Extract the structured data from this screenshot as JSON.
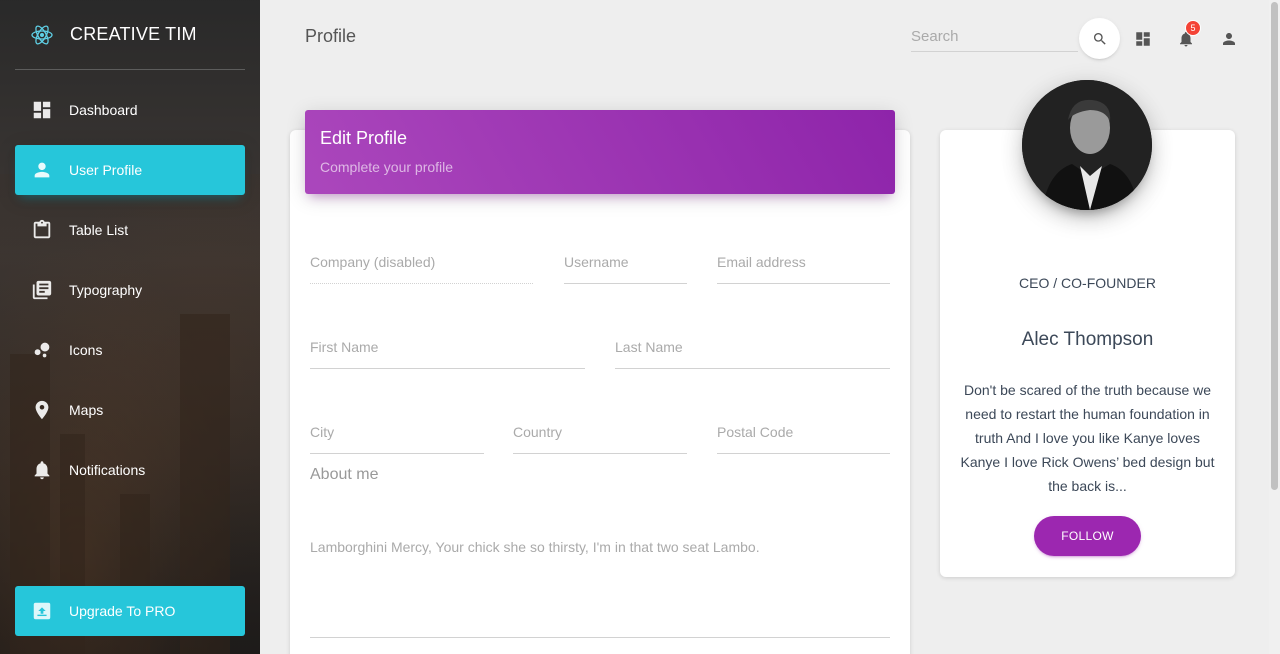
{
  "brand": {
    "name": "CREATIVE TIM",
    "logo_icon": "react-atom-icon",
    "accent": "#26c6da"
  },
  "sidebar": {
    "items": [
      {
        "label": "Dashboard",
        "icon": "dashboard-icon",
        "active": false
      },
      {
        "label": "User Profile",
        "icon": "person-icon",
        "active": true
      },
      {
        "label": "Table List",
        "icon": "clipboard-icon",
        "active": false
      },
      {
        "label": "Typography",
        "icon": "library-books-icon",
        "active": false
      },
      {
        "label": "Icons",
        "icon": "bubble-chart-icon",
        "active": false
      },
      {
        "label": "Maps",
        "icon": "location-pin-icon",
        "active": false
      },
      {
        "label": "Notifications",
        "icon": "bell-icon",
        "active": false
      }
    ],
    "upgrade_label": "Upgrade To PRO"
  },
  "header": {
    "title": "Profile",
    "search_placeholder": "Search",
    "notification_count": "5"
  },
  "edit_profile": {
    "title": "Edit Profile",
    "subtitle": "Complete your profile",
    "header_color": "#9c27b0",
    "fields": {
      "company": "Company (disabled)",
      "username": "Username",
      "email": "Email address",
      "first_name": "First Name",
      "last_name": "Last Name",
      "city": "City",
      "country": "Country",
      "postal_code": "Postal Code"
    },
    "about_title": "About me",
    "about_text": "Lamborghini Mercy, Your chick she so thirsty, I'm in that two seat Lambo."
  },
  "profile_card": {
    "role": "CEO / CO-FOUNDER",
    "name": "Alec Thompson",
    "bio": "Don't be scared of the truth because we need to restart the human foundation in truth And I love you like Kanye loves Kanye I love Rick Owens’ bed design but the back is...",
    "follow_label": "FOLLOW"
  }
}
